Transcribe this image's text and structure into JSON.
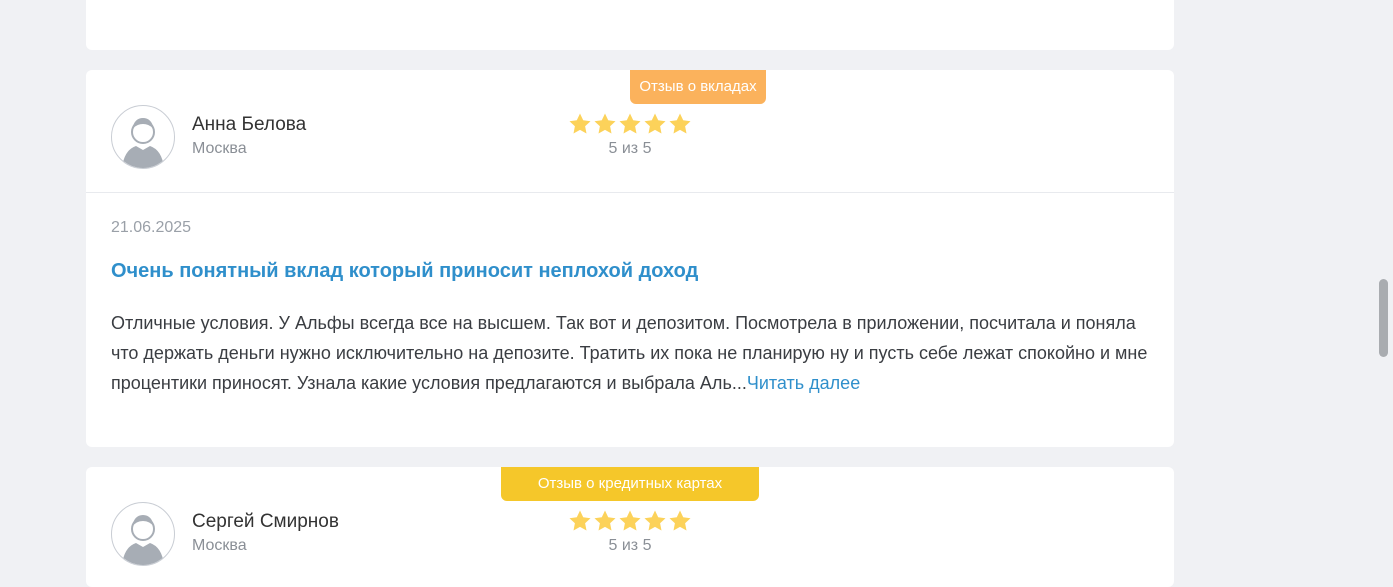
{
  "reviews": [
    {
      "badge": "Отзыв о вкладах",
      "badge_color": "#fbb25c",
      "author": "Анна Белова",
      "city": "Москва",
      "stars": 5,
      "rating_text": "5 из 5",
      "date": "21.06.2025",
      "title": "Очень понятный вклад который приносит неплохой доход",
      "text": "Отличные условия. У Альфы всегда все на высшем. Так вот и депозитом. Посмотрела в приложении, посчитала и поняла что держать деньги нужно исключительно на депозите. Тратить их пока не планирую ну и пусть себе лежат спокойно и мне процентики приносят. Узнала какие условия предлагаются и выбрала Аль...",
      "read_more": "Читать далее"
    },
    {
      "badge": "Отзыв о кредитных картах",
      "badge_color": "#f5c72a",
      "author": "Сергей Смирнов",
      "city": "Москва",
      "stars": 5,
      "rating_text": "5 из 5"
    }
  ],
  "icons": {
    "avatar": "user-avatar-icon",
    "star": "star-icon"
  },
  "colors": {
    "star": "#fcd25a",
    "link": "#2f8fcb"
  }
}
